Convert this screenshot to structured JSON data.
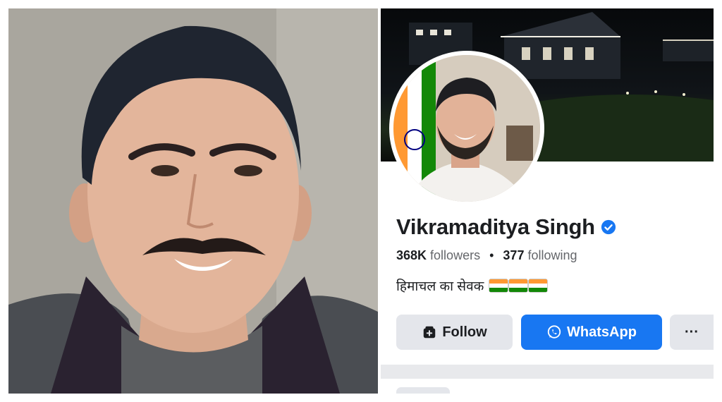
{
  "profile": {
    "name": "Vikramaditya Singh",
    "verified": true,
    "followers_count": "368K",
    "followers_label": "followers",
    "separator": "•",
    "following_count": "377",
    "following_label": "following",
    "bio": "हिमाचल का सेवक",
    "bio_flags": 3
  },
  "actions": {
    "follow_label": "Follow",
    "whatsapp_label": "WhatsApp",
    "more_label": "···"
  },
  "icons": {
    "verified": "verified-badge-icon",
    "follow": "follow-icon",
    "whatsapp": "whatsapp-icon",
    "more": "more-dots-icon",
    "flag": "india-flag-icon"
  },
  "colors": {
    "primary_button": "#1877f2",
    "secondary_button": "#e4e6eb",
    "verified_badge": "#1877f2",
    "text_primary": "#1c1e21",
    "text_secondary": "#65676b",
    "flag_saffron": "#ff9933",
    "flag_white": "#ffffff",
    "flag_green": "#138808"
  }
}
